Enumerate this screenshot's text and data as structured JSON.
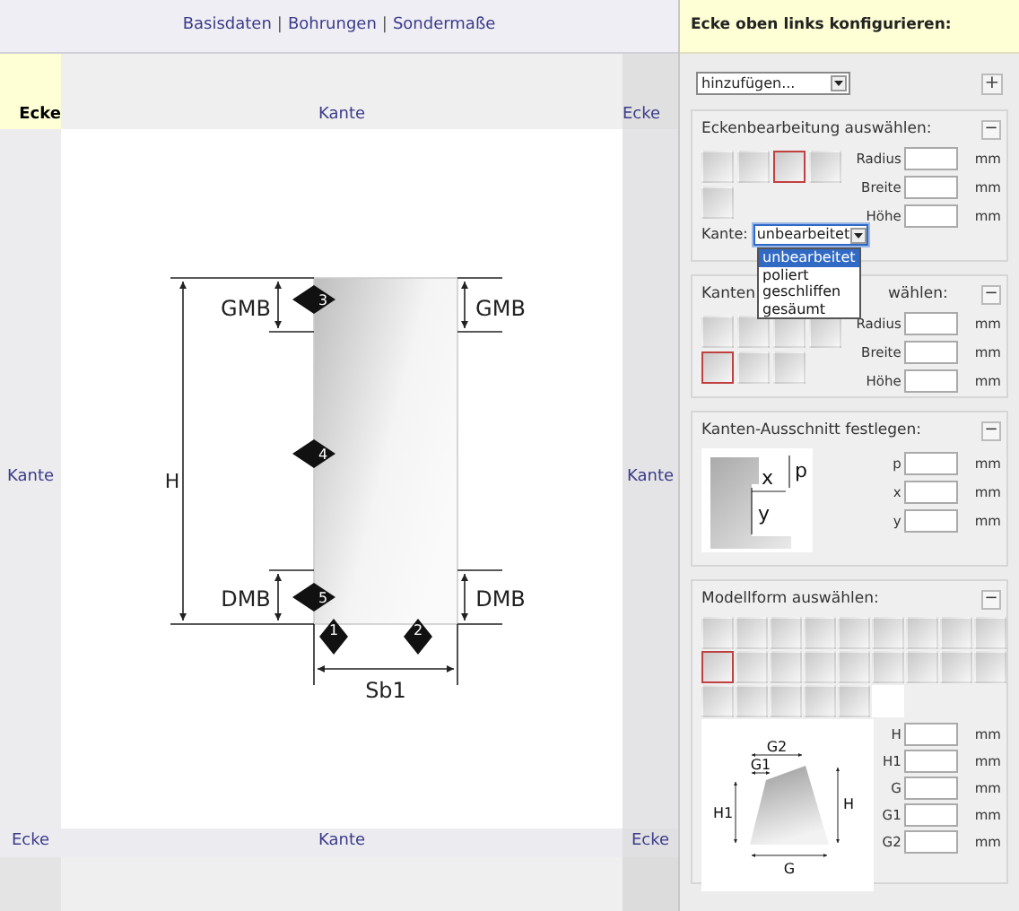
{
  "nav": {
    "links": [
      {
        "label": "Basisdaten"
      },
      {
        "label": "Bohrungen"
      },
      {
        "label": "Sondermaße"
      }
    ],
    "separator": "|"
  },
  "frame": {
    "top_left": "Ecke",
    "top": "Kante",
    "top_right": "Ecke",
    "left": "Kante",
    "right": "Kante",
    "bottom_left": "Ecke",
    "bottom": "Kante",
    "bottom_right": "Ecke"
  },
  "drawing": {
    "height_label": "H",
    "top_margin_labels": [
      "GMB",
      "GMB"
    ],
    "bottom_margin_labels": [
      "DMB",
      "DMB"
    ],
    "width_label": "Sb1",
    "markers": [
      {
        "number": "1"
      },
      {
        "number": "2"
      },
      {
        "number": "3"
      },
      {
        "number": "4"
      },
      {
        "number": "5"
      }
    ]
  },
  "panel": {
    "title": "Ecke oben links konfigurieren:",
    "add_select": {
      "value": "hinzufügen..."
    },
    "add_button": "+",
    "sections": [
      {
        "kind": "corner",
        "title": "Eckenbearbeitung auswählen:",
        "collapse": "−",
        "tiles": [
          {
            "selected": false
          },
          {
            "selected": false
          },
          {
            "selected": true
          },
          {
            "selected": false
          },
          {
            "selected": false
          }
        ],
        "fields": [
          {
            "label": "Radius",
            "unit": "mm"
          },
          {
            "label": "Breite",
            "unit": "mm"
          },
          {
            "label": "Höhe",
            "unit": "mm"
          }
        ],
        "edge_select": {
          "label": "Kante:",
          "value": "unbearbeitet",
          "expanded": true,
          "options": [
            {
              "label": "unbearbeitet",
              "selected": true
            },
            {
              "label": "poliert",
              "selected": false
            },
            {
              "label": "geschliffen",
              "selected": false
            },
            {
              "label": "gesäumt",
              "selected": false
            }
          ]
        }
      },
      {
        "kind": "edge",
        "title_parts": [
          "Kanten",
          "wählen:"
        ],
        "collapse": "−",
        "tiles": [
          {
            "selected": false
          },
          {
            "selected": false
          },
          {
            "selected": false
          },
          {
            "selected": false
          },
          {
            "selected": true
          },
          {
            "selected": false
          },
          {
            "selected": false
          }
        ],
        "fields": [
          {
            "label": "Radius",
            "unit": "mm"
          },
          {
            "label": "Breite",
            "unit": "mm"
          },
          {
            "label": "Höhe",
            "unit": "mm"
          }
        ]
      },
      {
        "kind": "cutout",
        "title": "Kanten-Ausschnitt festlegen:",
        "collapse": "−",
        "drawing_labels": [
          "x",
          "p",
          "y"
        ],
        "fields": [
          {
            "label": "p",
            "unit": "mm"
          },
          {
            "label": "x",
            "unit": "mm"
          },
          {
            "label": "y",
            "unit": "mm"
          }
        ]
      },
      {
        "kind": "model",
        "title": "Modellform auswählen:",
        "collapse": "−",
        "tiles": [
          {
            "selected": false
          },
          {
            "selected": false
          },
          {
            "selected": false
          },
          {
            "selected": false
          },
          {
            "selected": false
          },
          {
            "selected": false
          },
          {
            "selected": false
          },
          {
            "selected": false
          },
          {
            "selected": false
          },
          {
            "selected": true
          },
          {
            "selected": false
          },
          {
            "selected": false
          },
          {
            "selected": false
          },
          {
            "selected": false
          },
          {
            "selected": false
          },
          {
            "selected": false
          },
          {
            "selected": false
          },
          {
            "selected": false
          },
          {
            "selected": false
          },
          {
            "selected": false
          },
          {
            "selected": false
          },
          {
            "selected": false
          },
          {
            "selected": false
          },
          {
            "selected": false,
            "empty": true
          }
        ],
        "drawing_labels": [
          "G2",
          "G1",
          "H1",
          "H",
          "G"
        ],
        "fields": [
          {
            "label": "H",
            "unit": "mm"
          },
          {
            "label": "H1",
            "unit": "mm"
          },
          {
            "label": "G",
            "unit": "mm"
          },
          {
            "label": "G1",
            "unit": "mm"
          },
          {
            "label": "G2",
            "unit": "mm"
          }
        ]
      }
    ]
  }
}
